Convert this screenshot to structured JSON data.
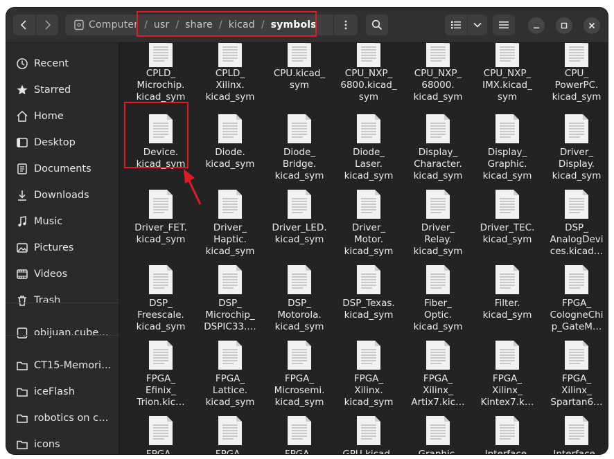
{
  "header": {
    "path": [
      {
        "label": "Computer"
      },
      {
        "label": "usr"
      },
      {
        "label": "share"
      },
      {
        "label": "kicad"
      },
      {
        "label": "symbols"
      }
    ]
  },
  "sidebar": {
    "items": [
      {
        "label": "Recent",
        "icon": "clock-icon"
      },
      {
        "label": "Starred",
        "icon": "star-icon"
      },
      {
        "label": "Home",
        "icon": "home-icon"
      },
      {
        "label": "Desktop",
        "icon": "desktop-icon"
      },
      {
        "label": "Documents",
        "icon": "document-icon"
      },
      {
        "label": "Downloads",
        "icon": "download-icon"
      },
      {
        "label": "Music",
        "icon": "music-icon"
      },
      {
        "label": "Pictures",
        "icon": "pictures-icon"
      },
      {
        "label": "Videos",
        "icon": "videos-icon"
      },
      {
        "label": "Trash",
        "icon": "trash-icon"
      },
      {
        "label": "obijuan.cube…",
        "icon": "drive-icon"
      },
      {
        "label": "CT15-Memori…",
        "icon": "folder-icon"
      },
      {
        "label": "iceFlash",
        "icon": "folder-icon"
      },
      {
        "label": "robotics on c…",
        "icon": "folder-icon"
      },
      {
        "label": "icons",
        "icon": "folder-icon"
      }
    ]
  },
  "files": [
    "CPLD_\nMicrochip.\nkicad_sym",
    "CPLD_\nXilinx.\nkicad_sym",
    "CPU.kicad_\nsym",
    "CPU_NXP_\n6800.kicad_\nsym",
    "CPU_NXP_\n68000.\nkicad_sym",
    "CPU_NXP_\nIMX.kicad_\nsym",
    "CPU_\nPowerPC.\nkicad_sym",
    "Device.\nkicad_sym",
    "Diode.\nkicad_sym",
    "Diode_\nBridge.\nkicad_sym",
    "Diode_\nLaser.\nkicad_sym",
    "Display_\nCharacter.\nkicad_sym",
    "Display_\nGraphic.\nkicad_sym",
    "Driver_\nDisplay.\nkicad_sym",
    "Driver_FET.\nkicad_sym",
    "Driver_\nHaptic.\nkicad_sym",
    "Driver_LED.\nkicad_sym",
    "Driver_\nMotor.\nkicad_sym",
    "Driver_\nRelay.\nkicad_sym",
    "Driver_TEC.\nkicad_sym",
    "DSP_\nAnalogDevi\nces.kicad…",
    "DSP_\nFreescale.\nkicad_sym",
    "DSP_\nMicrochip_\nDSPIC33.…",
    "DSP_\nMotorola.\nkicad_sym",
    "DSP_Texas.\nkicad_sym",
    "Fiber_\nOptic.\nkicad_sym",
    "Filter.\nkicad_sym",
    "FPGA_\nCologneChi\np_GateM…",
    "FPGA_\nEfinix_\nTrion.kic…",
    "FPGA_\nLattice.\nkicad_sym",
    "FPGA_\nMicrosemi.\nkicad_sym",
    "FPGA_\nXilinx.\nkicad_sym",
    "FPGA_\nXilinx_\nArtix7.kic…",
    "FPGA_\nXilinx_\nKintex7.k…",
    "FPGA_\nXilinx_\nSpartan6…",
    "FPGA_",
    "FPGA_",
    "FPGA_",
    "GPU.kicad_",
    "Graphic.",
    "Interface.",
    "Interface_"
  ],
  "colors": {
    "highlight": "#e01b24",
    "window_bg": "#2c2c2c",
    "content_bg": "#232323"
  }
}
